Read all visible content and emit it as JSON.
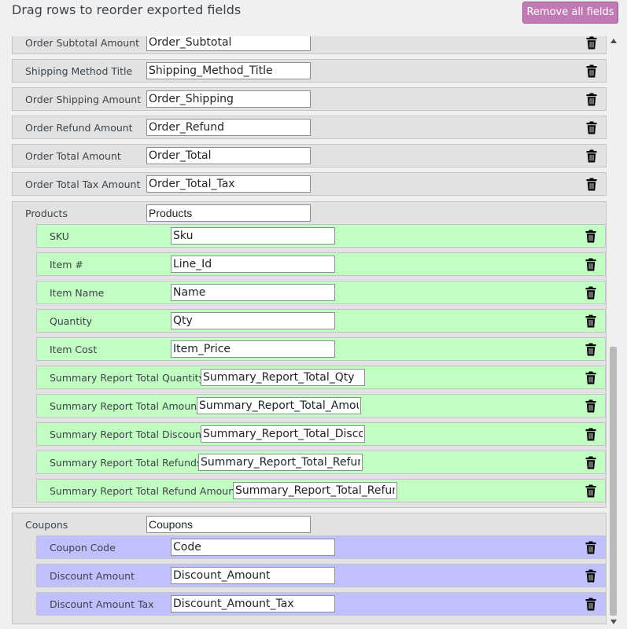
{
  "header": {
    "title": "Drag rows to reorder exported fields",
    "remove_all_label": "Remove all fields"
  },
  "top_rows": [
    {
      "label": "Order Subtotal Amount",
      "value": "Order_Subtotal"
    },
    {
      "label": "Shipping Method Title",
      "value": "Shipping_Method_Title"
    },
    {
      "label": "Order Shipping Amount",
      "value": "Order_Shipping"
    },
    {
      "label": "Order Refund Amount",
      "value": "Order_Refund"
    },
    {
      "label": "Order Total Amount",
      "value": "Order_Total"
    },
    {
      "label": "Order Total Tax Amount",
      "value": "Order_Total_Tax"
    }
  ],
  "products": {
    "label": "Products",
    "value": "Products",
    "rows": [
      {
        "label": "SKU",
        "value": "Sku"
      },
      {
        "label": "Item #",
        "value": "Line_Id"
      },
      {
        "label": "Item Name",
        "value": "Name"
      },
      {
        "label": "Quantity",
        "value": "Qty"
      },
      {
        "label": "Item Cost",
        "value": "Item_Price"
      },
      {
        "label": "Summary Report Total Quantity",
        "value": "Summary_Report_Total_Qty"
      },
      {
        "label": "Summary Report Total Amount",
        "value": "Summary_Report_Total_Amount"
      },
      {
        "label": "Summary Report Total Discount",
        "value": "Summary_Report_Total_Discount"
      },
      {
        "label": "Summary Report Total Refunds",
        "value": "Summary_Report_Total_Refunds"
      },
      {
        "label": "Summary Report Total Refund Amount",
        "value": "Summary_Report_Total_Refund_Amount"
      }
    ]
  },
  "coupons": {
    "label": "Coupons",
    "value": "Coupons",
    "rows": [
      {
        "label": "Coupon Code",
        "value": "Code"
      },
      {
        "label": "Discount Amount",
        "value": "Discount_Amount"
      },
      {
        "label": "Discount Amount Tax",
        "value": "Discount_Amount_Tax"
      }
    ]
  },
  "icons": {
    "delete": "trash-icon",
    "scroll_up": "arrow-up-icon",
    "scroll_down": "arrow-down-icon"
  },
  "colors": {
    "button_bg": "#c27ab4",
    "top_row_bg": "#e2e2e2",
    "product_row_bg": "#c2fec2",
    "coupon_row_bg": "#c0c0ff"
  }
}
